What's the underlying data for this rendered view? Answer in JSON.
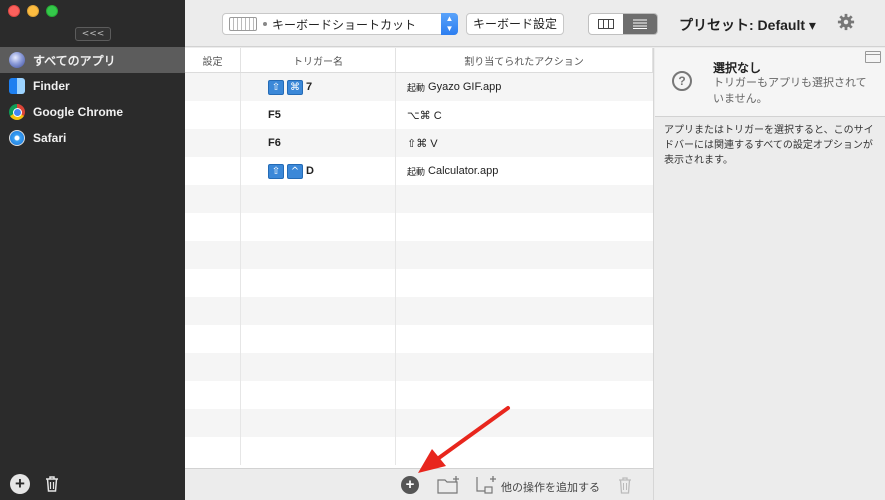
{
  "sidebar": {
    "collapse_label": "<<<",
    "apps": [
      {
        "label": "すべてのアプリ",
        "icon": "all-apps-icon",
        "active": true
      },
      {
        "label": "Finder",
        "icon": "finder-icon",
        "active": false
      },
      {
        "label": "Google Chrome",
        "icon": "chrome-icon",
        "active": false
      },
      {
        "label": "Safari",
        "icon": "safari-icon",
        "active": false
      }
    ],
    "add_label": "+"
  },
  "toolbar": {
    "trigger_type": "キーボードショートカット",
    "keyboard_settings_label": "キーボード設定",
    "preset_label": "プリセット: Default ▾"
  },
  "table": {
    "headers": [
      "設定",
      "トリガー名",
      "割り当てられたアクション"
    ],
    "rows": [
      {
        "keys": [
          "⇧",
          "⌘"
        ],
        "key_text": "7",
        "action_prefix": "起動",
        "action": "Gyazo GIF.app"
      },
      {
        "keys": [],
        "key_text": "F5",
        "action_prefix": "",
        "action": "⌥⌘ C"
      },
      {
        "keys": [],
        "key_text": "F6",
        "action_prefix": "",
        "action": "⇧⌘ V"
      },
      {
        "keys": [
          "⇧",
          "^"
        ],
        "key_text": "D",
        "action_prefix": "起動",
        "action": "Calculator.app"
      }
    ],
    "empty_rows": 10
  },
  "footer": {
    "add_label": "+",
    "add_action_label": "他の操作を追加する"
  },
  "right_panel": {
    "title": "選択なし",
    "subtitle": "トリガーもアプリも選択されていません。",
    "description": "アプリまたはトリガーを選択すると、このサイドバーには関連するすべての設定オプションが表示されます。"
  },
  "colors": {
    "sidebar_bg": "#2b2b2b",
    "key_chip": "#3b88d8",
    "annotation_arrow": "#e8261d"
  }
}
